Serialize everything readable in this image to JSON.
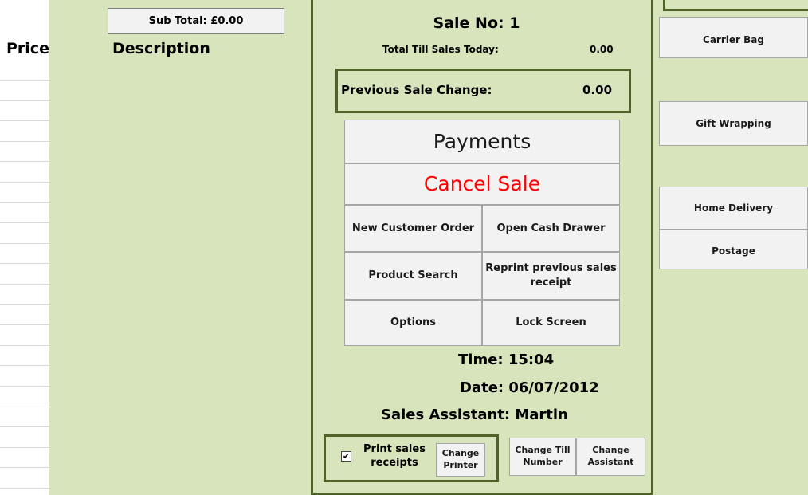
{
  "left": {
    "subtotal_label": "Sub Total: £0.00",
    "price_header": "Price",
    "description_header": "Description"
  },
  "middle": {
    "sale_no": "Sale No: 1",
    "till_sales_label": "Total Till Sales Today:",
    "till_sales_value": "0.00",
    "previous_change_label": "Previous Sale Change:",
    "previous_change_value": "0.00",
    "payments_label": "Payments",
    "cancel_label": "Cancel Sale",
    "new_customer_label": "New Customer Order",
    "cash_drawer_label": "Open Cash Drawer",
    "product_search_label": "Product Search",
    "reprint_label": "Reprint previous sales receipt",
    "options_label": "Options",
    "lock_label": "Lock Screen",
    "time": "Time: 15:04",
    "date": "Date: 06/07/2012",
    "assistant": "Sales Assistant: Martin",
    "print_receipts_label": "Print sales receipts",
    "print_receipts_checked": true,
    "change_printer_label": "Change Printer",
    "change_till_label": "Change Till Number",
    "change_assistant_label": "Change Assistant"
  },
  "right": {
    "buttons": [
      "Carrier Bag",
      "Gift Wrapping",
      "Home Delivery",
      "Postage"
    ]
  },
  "colors": {
    "panel_bg": "#d8e4bc",
    "border_dark_green": "#4f6228",
    "cancel_red": "#ff0000",
    "button_bg": "#f2f2f2"
  }
}
